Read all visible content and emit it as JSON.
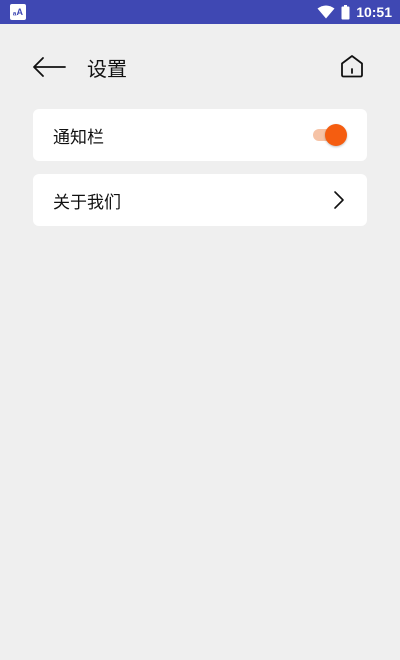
{
  "status_bar": {
    "app_badge": "ₐA",
    "time": "10:51",
    "icons": [
      "wifi-icon",
      "battery-icon"
    ],
    "background": "#3f48b3"
  },
  "header": {
    "title": "设置",
    "back_icon": "arrow-left-icon",
    "home_icon": "home-icon"
  },
  "settings": {
    "notification_bar": {
      "label": "通知栏",
      "toggle_on": true,
      "accent": "#f55d10"
    },
    "about_us": {
      "label": "关于我们",
      "icon": "chevron-right-icon"
    }
  }
}
